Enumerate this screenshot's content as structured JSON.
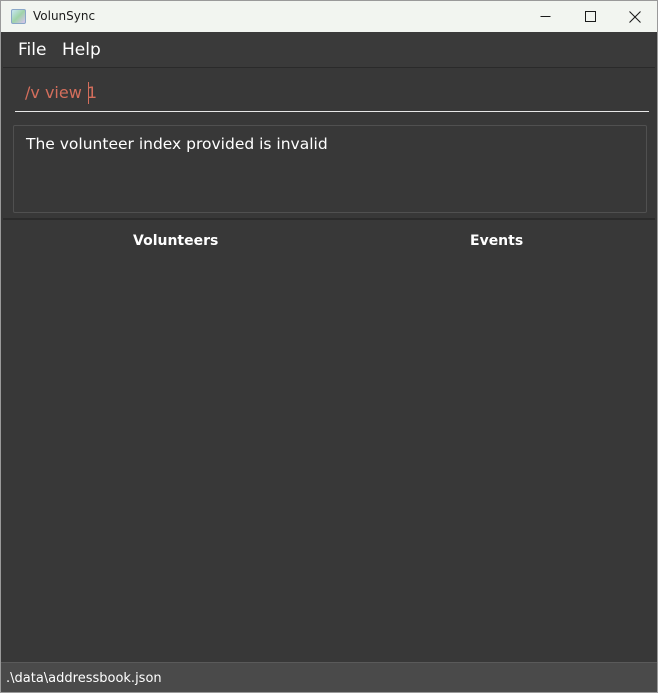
{
  "window": {
    "title": "VolunSync",
    "icon": "volunsync-app-icon"
  },
  "menu": {
    "file_label": "File",
    "help_label": "Help"
  },
  "command": {
    "value": "/v view 1",
    "text_color": "#d46e5c"
  },
  "result": {
    "message": "The volunteer index provided is invalid"
  },
  "panels": {
    "volunteers_title": "Volunteers",
    "events_title": "Events"
  },
  "status": {
    "save_path": ".\\data\\addressbook.json"
  },
  "colors": {
    "window_bg": "#383838",
    "titlebar_bg": "#f2f5f0",
    "status_bg": "#4a4a4a"
  }
}
